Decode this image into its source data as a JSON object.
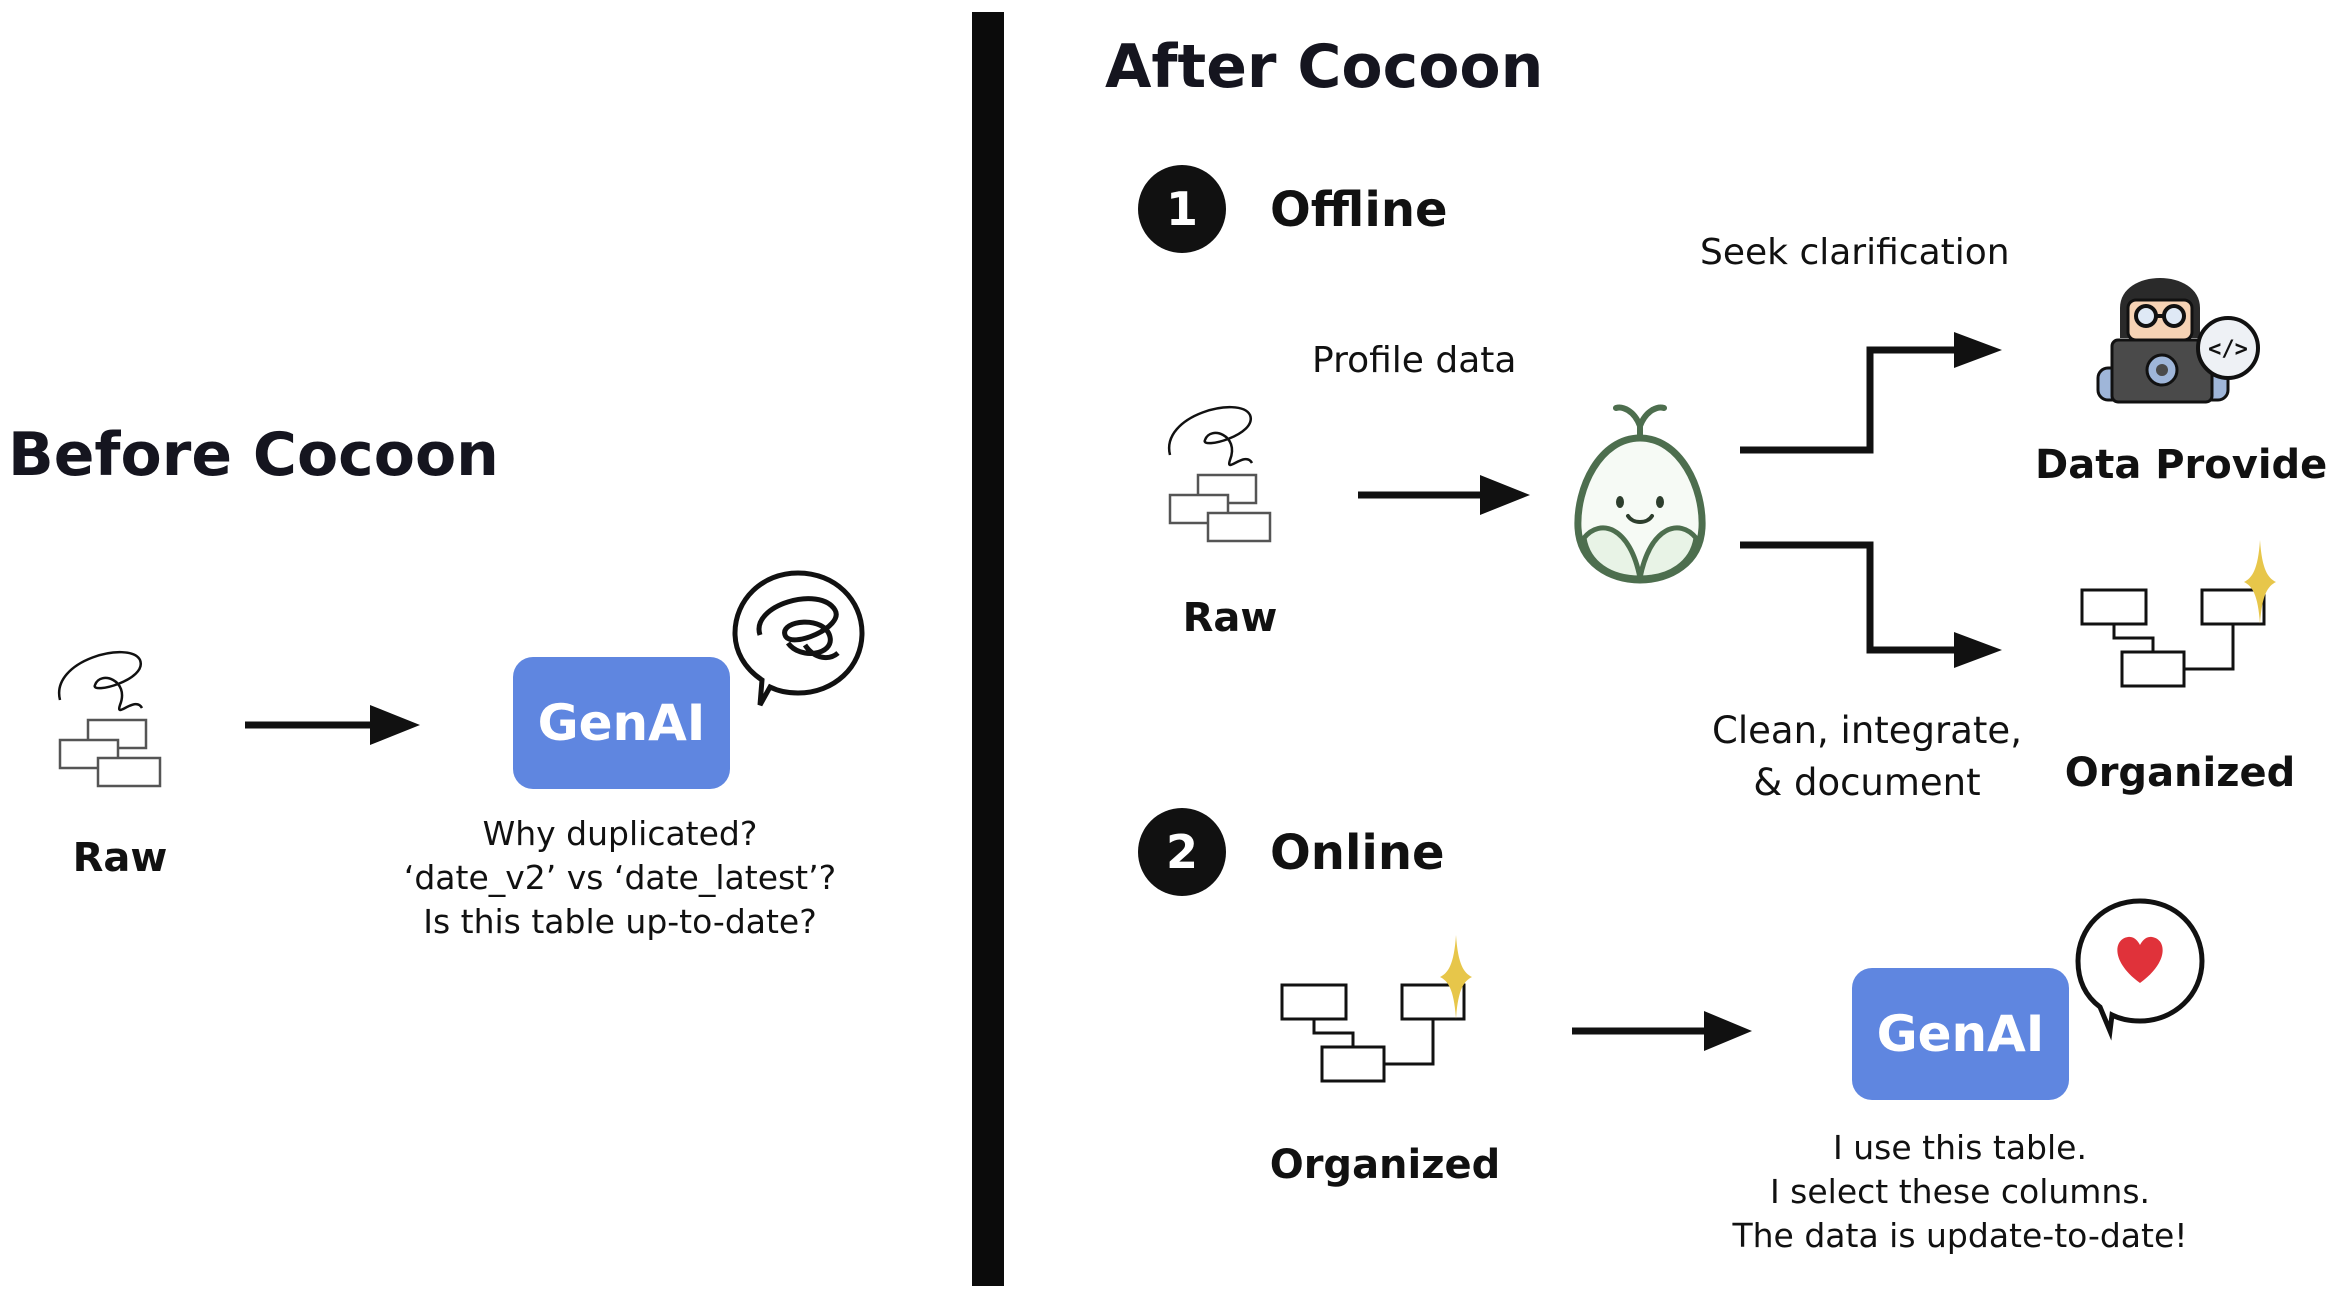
{
  "before": {
    "title": "Before Cocoon",
    "raw_label": "Raw",
    "genai_label": "GenAI",
    "questions": [
      "Why duplicated?",
      "‘date_v2’ vs ‘date_latest’?",
      "Is this table up-to-date?"
    ]
  },
  "after": {
    "title": "After Cocoon",
    "offline": {
      "step_number": "1",
      "label": "Offline",
      "raw_label": "Raw",
      "profile_label": "Profile data",
      "seek_label": "Seek clarification",
      "provider_label": "Data Provider",
      "clean_lines": [
        "Clean, integrate,",
        "& document"
      ],
      "organized_label": "Organized"
    },
    "online": {
      "step_number": "2",
      "label": "Online",
      "organized_label": "Organized",
      "genai_label": "GenAI",
      "responses": [
        "I use this table.",
        "I select these columns.",
        "The data is update-to-date!"
      ]
    }
  },
  "colors": {
    "genai": "#5f86e0",
    "sparkle": "#e7c64a",
    "heart": "#e0323a",
    "cocoon_outline": "#4d6e4e",
    "cocoon_leaf": "#e8f3e6"
  },
  "icons": [
    "raw-data-icon",
    "scribble-bubble-icon",
    "cocoon-mascot-icon",
    "data-provider-icon",
    "organized-data-icon",
    "sparkle-icon",
    "heart-bubble-icon"
  ]
}
